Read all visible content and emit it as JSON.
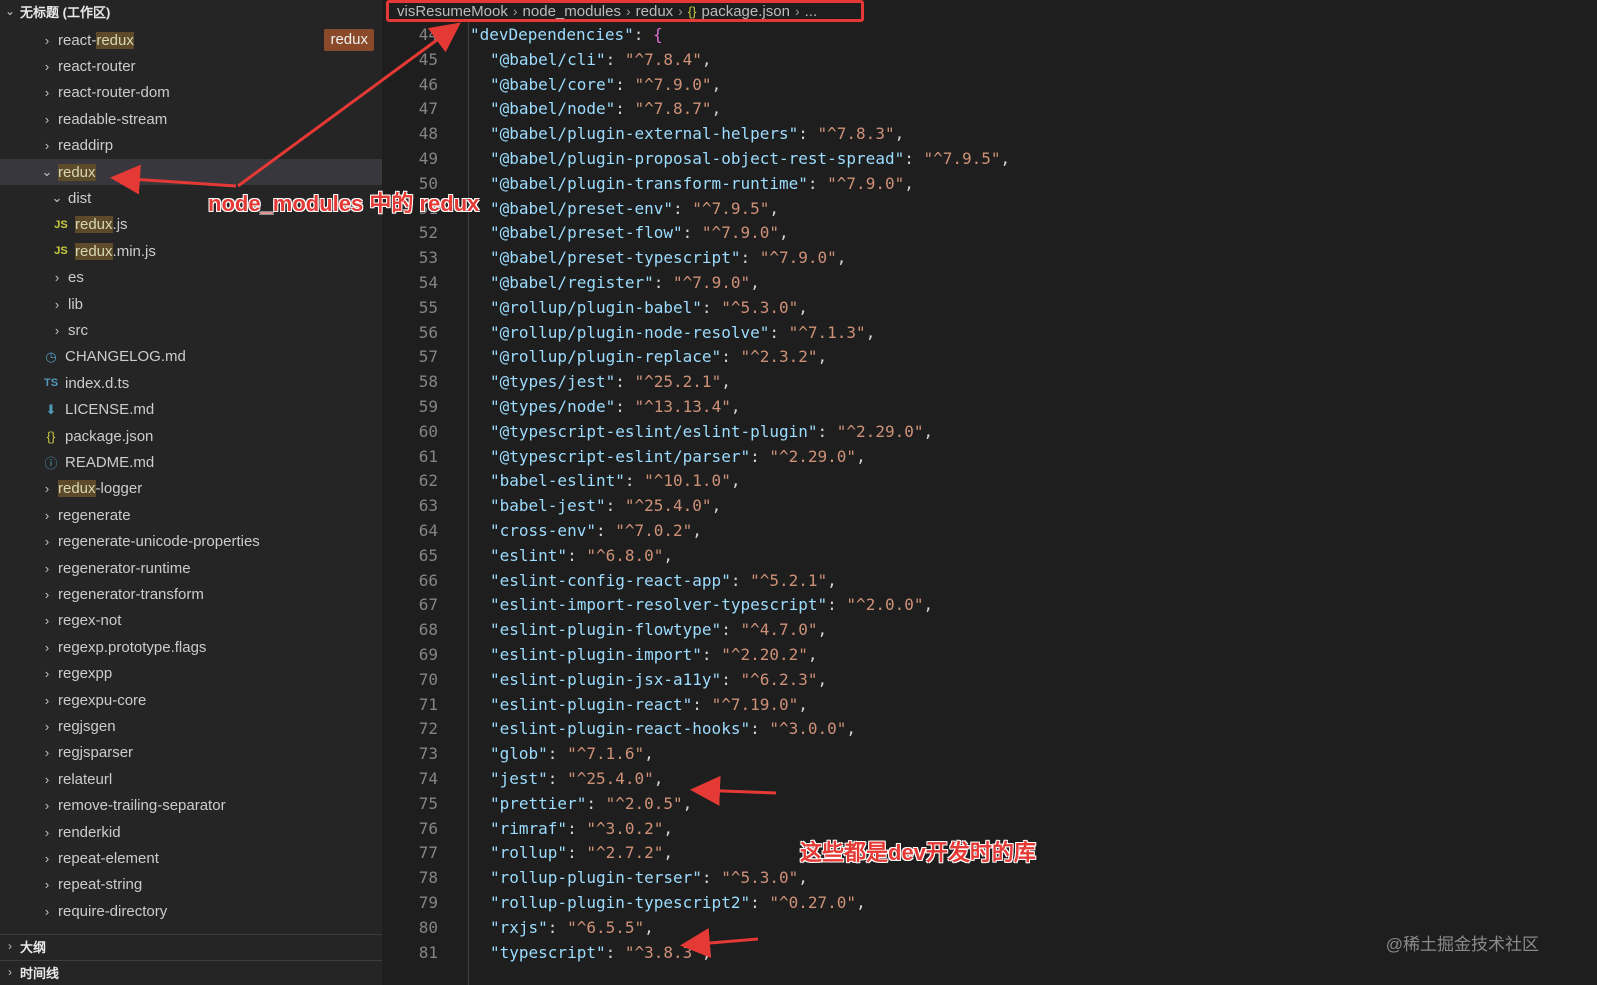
{
  "sidebar": {
    "workspace_title": "无标题 (工作区)",
    "items": [
      {
        "pre": "react-",
        "hl": "redux",
        "post": "",
        "kind": "folder",
        "open": false,
        "indent": 0
      },
      {
        "pre": "react-router",
        "hl": "",
        "post": "",
        "kind": "folder",
        "open": false,
        "indent": 0
      },
      {
        "pre": "react-router-dom",
        "hl": "",
        "post": "",
        "kind": "folder",
        "open": false,
        "indent": 0
      },
      {
        "pre": "readable-stream",
        "hl": "",
        "post": "",
        "kind": "folder",
        "open": false,
        "indent": 0
      },
      {
        "pre": "readdirp",
        "hl": "",
        "post": "",
        "kind": "folder",
        "open": false,
        "indent": 0
      },
      {
        "pre": "",
        "hl": "redux",
        "post": "",
        "kind": "folder",
        "open": true,
        "indent": 0,
        "selected": true
      },
      {
        "pre": "dist",
        "hl": "",
        "post": "",
        "kind": "folder",
        "open": true,
        "indent": 1
      },
      {
        "pre": "",
        "hl": "redux",
        "post": ".js",
        "kind": "js",
        "indent": 2
      },
      {
        "pre": "",
        "hl": "redux",
        "post": ".min.js",
        "kind": "js",
        "indent": 2
      },
      {
        "pre": "es",
        "hl": "",
        "post": "",
        "kind": "folder",
        "open": false,
        "indent": 1
      },
      {
        "pre": "lib",
        "hl": "",
        "post": "",
        "kind": "folder",
        "open": false,
        "indent": 1
      },
      {
        "pre": "src",
        "hl": "",
        "post": "",
        "kind": "folder",
        "open": false,
        "indent": 1
      },
      {
        "pre": "CHANGELOG.md",
        "hl": "",
        "post": "",
        "kind": "md",
        "indent": 1
      },
      {
        "pre": "index.d.ts",
        "hl": "",
        "post": "",
        "kind": "ts",
        "indent": 1
      },
      {
        "pre": "LICENSE.md",
        "hl": "",
        "post": "",
        "kind": "lic",
        "indent": 1
      },
      {
        "pre": "package.json",
        "hl": "",
        "post": "",
        "kind": "json",
        "indent": 1
      },
      {
        "pre": "README.md",
        "hl": "",
        "post": "",
        "kind": "info",
        "indent": 1
      },
      {
        "pre": "",
        "hl": "redux",
        "post": "-logger",
        "kind": "folder",
        "open": false,
        "indent": 0
      },
      {
        "pre": "regenerate",
        "hl": "",
        "post": "",
        "kind": "folder",
        "open": false,
        "indent": 0
      },
      {
        "pre": "regenerate-unicode-properties",
        "hl": "",
        "post": "",
        "kind": "folder",
        "open": false,
        "indent": 0
      },
      {
        "pre": "regenerator-runtime",
        "hl": "",
        "post": "",
        "kind": "folder",
        "open": false,
        "indent": 0
      },
      {
        "pre": "regenerator-transform",
        "hl": "",
        "post": "",
        "kind": "folder",
        "open": false,
        "indent": 0
      },
      {
        "pre": "regex-not",
        "hl": "",
        "post": "",
        "kind": "folder",
        "open": false,
        "indent": 0
      },
      {
        "pre": "regexp.prototype.flags",
        "hl": "",
        "post": "",
        "kind": "folder",
        "open": false,
        "indent": 0
      },
      {
        "pre": "regexpp",
        "hl": "",
        "post": "",
        "kind": "folder",
        "open": false,
        "indent": 0
      },
      {
        "pre": "regexpu-core",
        "hl": "",
        "post": "",
        "kind": "folder",
        "open": false,
        "indent": 0
      },
      {
        "pre": "regjsgen",
        "hl": "",
        "post": "",
        "kind": "folder",
        "open": false,
        "indent": 0
      },
      {
        "pre": "regjsparser",
        "hl": "",
        "post": "",
        "kind": "folder",
        "open": false,
        "indent": 0
      },
      {
        "pre": "relateurl",
        "hl": "",
        "post": "",
        "kind": "folder",
        "open": false,
        "indent": 0
      },
      {
        "pre": "remove-trailing-separator",
        "hl": "",
        "post": "",
        "kind": "folder",
        "open": false,
        "indent": 0
      },
      {
        "pre": "renderkid",
        "hl": "",
        "post": "",
        "kind": "folder",
        "open": false,
        "indent": 0
      },
      {
        "pre": "repeat-element",
        "hl": "",
        "post": "",
        "kind": "folder",
        "open": false,
        "indent": 0
      },
      {
        "pre": "repeat-string",
        "hl": "",
        "post": "",
        "kind": "folder",
        "open": false,
        "indent": 0
      },
      {
        "pre": "require-directory",
        "hl": "",
        "post": "",
        "kind": "folder",
        "open": false,
        "indent": 0
      }
    ],
    "search_badge": "redux",
    "outline_label": "大纲",
    "timeline_label": "时间线"
  },
  "breadcrumb": {
    "items": [
      "visResumeMook",
      "node_modules",
      "redux",
      "package.json",
      "..."
    ]
  },
  "code": {
    "first_line": 44,
    "lines": [
      {
        "key": "devDependencies",
        "open": true
      },
      {
        "key": "@babel/cli",
        "val": "^7.8.4"
      },
      {
        "key": "@babel/core",
        "val": "^7.9.0"
      },
      {
        "key": "@babel/node",
        "val": "^7.8.7"
      },
      {
        "key": "@babel/plugin-external-helpers",
        "val": "^7.8.3"
      },
      {
        "key": "@babel/plugin-proposal-object-rest-spread",
        "val": "^7.9.5"
      },
      {
        "key": "@babel/plugin-transform-runtime",
        "val": "^7.9.0"
      },
      {
        "key": "@babel/preset-env",
        "val": "^7.9.5"
      },
      {
        "key": "@babel/preset-flow",
        "val": "^7.9.0"
      },
      {
        "key": "@babel/preset-typescript",
        "val": "^7.9.0"
      },
      {
        "key": "@babel/register",
        "val": "^7.9.0"
      },
      {
        "key": "@rollup/plugin-babel",
        "val": "^5.3.0"
      },
      {
        "key": "@rollup/plugin-node-resolve",
        "val": "^7.1.3"
      },
      {
        "key": "@rollup/plugin-replace",
        "val": "^2.3.2"
      },
      {
        "key": "@types/jest",
        "val": "^25.2.1"
      },
      {
        "key": "@types/node",
        "val": "^13.13.4"
      },
      {
        "key": "@typescript-eslint/eslint-plugin",
        "val": "^2.29.0"
      },
      {
        "key": "@typescript-eslint/parser",
        "val": "^2.29.0"
      },
      {
        "key": "babel-eslint",
        "val": "^10.1.0"
      },
      {
        "key": "babel-jest",
        "val": "^25.4.0"
      },
      {
        "key": "cross-env",
        "val": "^7.0.2"
      },
      {
        "key": "eslint",
        "val": "^6.8.0"
      },
      {
        "key": "eslint-config-react-app",
        "val": "^5.2.1"
      },
      {
        "key": "eslint-import-resolver-typescript",
        "val": "^2.0.0"
      },
      {
        "key": "eslint-plugin-flowtype",
        "val": "^4.7.0"
      },
      {
        "key": "eslint-plugin-import",
        "val": "^2.20.2"
      },
      {
        "key": "eslint-plugin-jsx-a11y",
        "val": "^6.2.3"
      },
      {
        "key": "eslint-plugin-react",
        "val": "^7.19.0"
      },
      {
        "key": "eslint-plugin-react-hooks",
        "val": "^3.0.0"
      },
      {
        "key": "glob",
        "val": "^7.1.6"
      },
      {
        "key": "jest",
        "val": "^25.4.0"
      },
      {
        "key": "prettier",
        "val": "^2.0.5"
      },
      {
        "key": "rimraf",
        "val": "^3.0.2"
      },
      {
        "key": "rollup",
        "val": "^2.7.2"
      },
      {
        "key": "rollup-plugin-terser",
        "val": "^5.3.0"
      },
      {
        "key": "rollup-plugin-typescript2",
        "val": "^0.27.0"
      },
      {
        "key": "rxjs",
        "val": "^6.5.5"
      },
      {
        "key": "typescript",
        "val": "^3.8.3"
      }
    ]
  },
  "annotations": {
    "node_modules_redux": "node_modules 中的 redux",
    "dev_libs": "这些都是dev开发时的库"
  },
  "watermark": "@稀土掘金技术社区",
  "colors": {
    "annotation_red": "#e53935",
    "sidebar_bg": "#252526",
    "editor_bg": "#1e1e1e",
    "json_key": "#9cdcfe",
    "json_string": "#ce9178"
  }
}
